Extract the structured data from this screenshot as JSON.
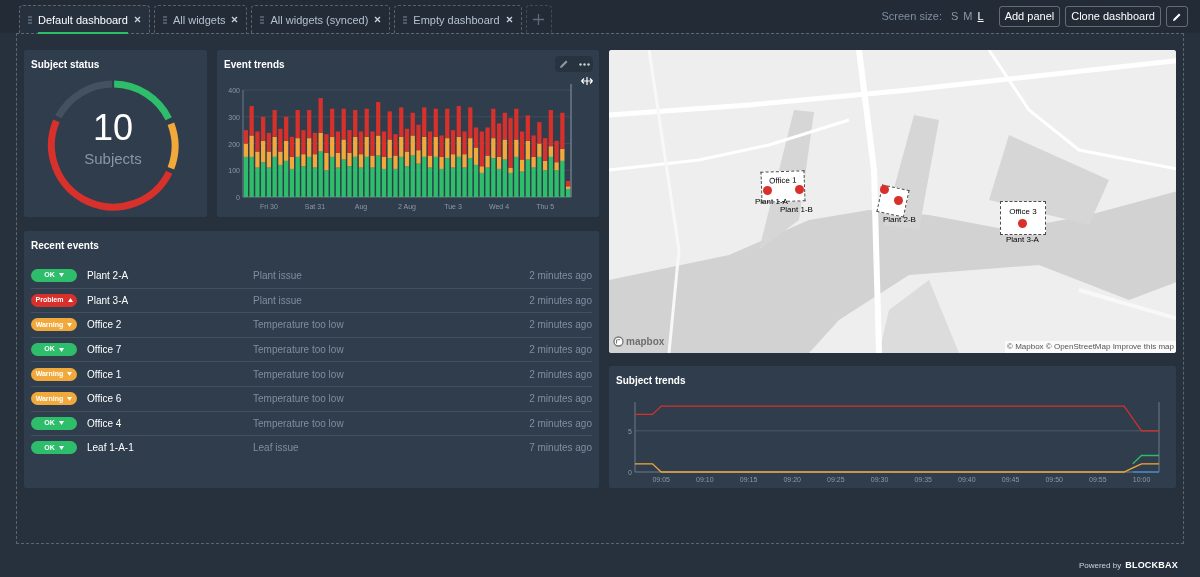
{
  "tabs": [
    {
      "label": "Default dashboard",
      "selected": true
    },
    {
      "label": "All widgets",
      "selected": false
    },
    {
      "label": "All widgets (synced)",
      "selected": false
    },
    {
      "label": "Empty dashboard",
      "selected": false
    }
  ],
  "toolbar": {
    "screen_size_label": "Screen size:",
    "sizes": [
      {
        "label": "S",
        "selected": false
      },
      {
        "label": "M",
        "selected": false
      },
      {
        "label": "L",
        "selected": true
      }
    ],
    "buttons": [
      "Add panel",
      "Clone dashboard"
    ]
  },
  "subject_status": {
    "title": "Subject status",
    "count": "10",
    "label": "Subjects"
  },
  "event_trends": {
    "title": "Event trends",
    "chart_data": {
      "type": "bar",
      "stacked": true,
      "grid": true,
      "ylim": [
        0,
        400
      ],
      "yticks": [
        0,
        100,
        200,
        300,
        400
      ],
      "categories": [
        null,
        null,
        null,
        null,
        "Fri 30",
        null,
        null,
        null,
        null,
        null,
        null,
        null,
        "Sat 31",
        null,
        null,
        null,
        null,
        null,
        null,
        null,
        "Aug",
        null,
        null,
        null,
        null,
        null,
        null,
        null,
        "2 Aug",
        null,
        null,
        null,
        null,
        null,
        null,
        null,
        "Tue 3",
        null,
        null,
        null,
        null,
        null,
        null,
        null,
        "Wed 4",
        null,
        null,
        null,
        null,
        null,
        null,
        null,
        "Thu 5",
        null,
        null,
        null,
        null
      ],
      "series": [
        {
          "color": "#2ebd6b",
          "values": [
            150,
            150,
            110,
            130,
            110,
            150,
            120,
            135,
            105,
            150,
            115,
            150,
            110,
            170,
            100,
            150,
            110,
            140,
            115,
            150,
            110,
            150,
            110,
            155,
            105,
            145,
            105,
            150,
            115,
            155,
            125,
            150,
            110,
            150,
            105,
            145,
            110,
            150,
            110,
            145,
            120,
            90,
            110,
            145,
            105,
            140,
            90,
            150,
            95,
            140,
            110,
            150,
            100,
            150,
            100,
            135,
            30
          ]
        },
        {
          "color": "#f2a93b",
          "values": [
            50,
            80,
            60,
            80,
            60,
            75,
            50,
            75,
            45,
            70,
            45,
            70,
            50,
            70,
            65,
            75,
            55,
            75,
            50,
            75,
            50,
            75,
            45,
            75,
            45,
            70,
            50,
            75,
            55,
            75,
            50,
            75,
            45,
            75,
            45,
            75,
            50,
            75,
            50,
            75,
            65,
            25,
            45,
            75,
            45,
            75,
            20,
            65,
            45,
            70,
            40,
            50,
            35,
            40,
            30,
            45,
            10
          ]
        },
        {
          "color": "#d8302a",
          "values": [
            50,
            110,
            75,
            90,
            70,
            100,
            85,
            90,
            75,
            105,
            90,
            105,
            80,
            130,
            70,
            105,
            80,
            115,
            85,
            100,
            85,
            105,
            90,
            125,
            95,
            105,
            80,
            110,
            85,
            85,
            95,
            110,
            90,
            105,
            80,
            110,
            90,
            115,
            85,
            115,
            75,
            130,
            105,
            110,
            125,
            100,
            185,
            115,
            105,
            95,
            80,
            80,
            85,
            135,
            80,
            135,
            20
          ]
        }
      ]
    }
  },
  "recent_events": {
    "title": "Recent events",
    "rows": [
      {
        "status": "OK",
        "color": "#2ebd6b",
        "trend_up": false,
        "subject": "Plant 2-A",
        "description": "Plant issue",
        "time": "2 minutes ago"
      },
      {
        "status": "Problem",
        "color": "#d8302a",
        "trend_up": true,
        "subject": "Plant 3-A",
        "description": "Plant issue",
        "time": "2 minutes ago"
      },
      {
        "status": "Warning",
        "color": "#f2a93b",
        "trend_up": false,
        "subject": "Office 2",
        "description": "Temperature too low",
        "time": "2 minutes ago"
      },
      {
        "status": "OK",
        "color": "#2ebd6b",
        "trend_up": false,
        "subject": "Office 7",
        "description": "Temperature too low",
        "time": "2 minutes ago"
      },
      {
        "status": "Warning",
        "color": "#f2a93b",
        "trend_up": false,
        "subject": "Office 1",
        "description": "Temperature too low",
        "time": "2 minutes ago"
      },
      {
        "status": "Warning",
        "color": "#f2a93b",
        "trend_up": false,
        "subject": "Office 6",
        "description": "Temperature too low",
        "time": "2 minutes ago"
      },
      {
        "status": "OK",
        "color": "#2ebd6b",
        "trend_up": false,
        "subject": "Office 4",
        "description": "Temperature too low",
        "time": "2 minutes ago"
      },
      {
        "status": "OK",
        "color": "#2ebd6b",
        "trend_up": false,
        "subject": "Leaf 1-A-1",
        "description": "Leaf issue",
        "time": "7 minutes ago"
      }
    ]
  },
  "map": {
    "logo": "mapbox",
    "attribution": "© Mapbox © OpenStreetMap Improve this map",
    "buildings": [
      "Office 1",
      "Office 3"
    ],
    "markers": [
      "Plant 1-A",
      "Plant 1-B",
      "Plant 2-B",
      "Plant 3-A"
    ]
  },
  "subject_trends": {
    "title": "Subject trends",
    "chart_data": {
      "type": "line",
      "grid": true,
      "ylim": [
        0,
        8.5
      ],
      "yticks": [
        0,
        5
      ],
      "categories": [
        null,
        null,
        null,
        "09:05",
        null,
        null,
        null,
        null,
        "09:10",
        null,
        null,
        null,
        null,
        "09:15",
        null,
        null,
        null,
        null,
        "09:20",
        null,
        null,
        null,
        null,
        "09:25",
        null,
        null,
        null,
        null,
        "09:30",
        null,
        null,
        null,
        null,
        "09:35",
        null,
        null,
        null,
        null,
        "09:40",
        null,
        null,
        null,
        null,
        "09:45",
        null,
        null,
        null,
        null,
        "09:50",
        null,
        null,
        null,
        null,
        "09:55",
        null,
        null,
        null,
        null,
        "10:00",
        null,
        null
      ],
      "series": [
        {
          "color": "#d8302a",
          "values": [
            7,
            7,
            7,
            8,
            8,
            8,
            8,
            8,
            8,
            8,
            8,
            8,
            8,
            8,
            8,
            8,
            8,
            8,
            8,
            8,
            8,
            8,
            8,
            8,
            8,
            8,
            8,
            8,
            8,
            8,
            8,
            8,
            8,
            8,
            8,
            8,
            8,
            8,
            8,
            8,
            8,
            8,
            8,
            8,
            8,
            8,
            8,
            8,
            8,
            8,
            8,
            8,
            8,
            8,
            8,
            8,
            8,
            6.5,
            5,
            5,
            5
          ]
        },
        {
          "color": "#3b8fd1",
          "values": [
            null,
            null,
            null,
            null,
            null,
            null,
            null,
            null,
            null,
            null,
            null,
            null,
            null,
            null,
            null,
            null,
            null,
            null,
            null,
            null,
            null,
            null,
            null,
            null,
            null,
            null,
            null,
            null,
            null,
            null,
            null,
            null,
            null,
            null,
            null,
            null,
            null,
            null,
            null,
            null,
            null,
            null,
            null,
            null,
            null,
            null,
            null,
            null,
            null,
            null,
            null,
            null,
            null,
            null,
            null,
            null,
            null,
            0,
            0,
            0,
            0
          ]
        },
        {
          "color": "#2ebd6b",
          "values": [
            null,
            null,
            null,
            null,
            null,
            null,
            null,
            null,
            null,
            null,
            null,
            null,
            null,
            null,
            null,
            null,
            null,
            null,
            null,
            null,
            null,
            null,
            null,
            null,
            null,
            null,
            null,
            null,
            null,
            null,
            null,
            null,
            null,
            null,
            null,
            null,
            null,
            null,
            null,
            null,
            null,
            null,
            null,
            null,
            null,
            null,
            null,
            null,
            null,
            null,
            null,
            null,
            null,
            null,
            null,
            null,
            null,
            1,
            2,
            2,
            2
          ]
        },
        {
          "color": "#f2a93b",
          "values": [
            1,
            1,
            1,
            0,
            0,
            0,
            0,
            0,
            0,
            0,
            0,
            0,
            0,
            0,
            0,
            0,
            0,
            0,
            0,
            0,
            0,
            0,
            0,
            0,
            0,
            0,
            0,
            0,
            0,
            0,
            0,
            0,
            0,
            0,
            0,
            0,
            0,
            0,
            0,
            0,
            0,
            0,
            0,
            0,
            0,
            0,
            0,
            0,
            0,
            0,
            0,
            0,
            0,
            0,
            0,
            0,
            0,
            0.5,
            1,
            1,
            1
          ]
        }
      ]
    }
  },
  "footer": {
    "powered_by": "Powered by",
    "brand": "BLOCKBAX"
  }
}
